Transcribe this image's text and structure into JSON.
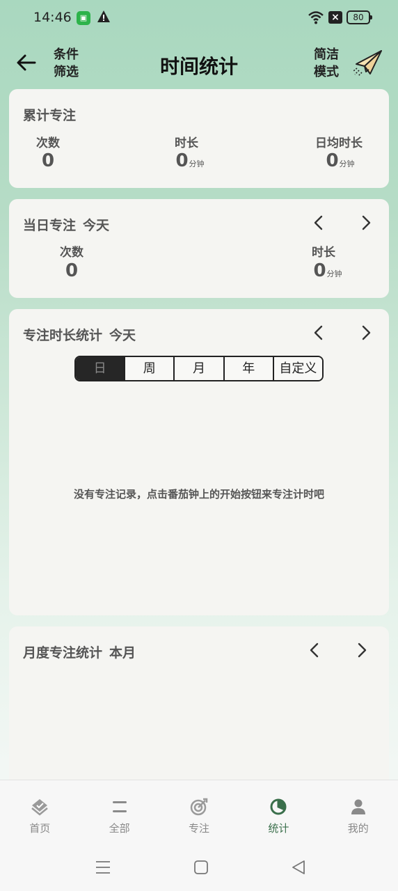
{
  "status_bar": {
    "time": "14:46",
    "battery": "80"
  },
  "header": {
    "title": "时间统计",
    "filter_label": "条件\n筛选",
    "simple_mode_label": "简洁\n模式"
  },
  "cumulative": {
    "title": "累计专注",
    "count_label": "次数",
    "count_value": "0",
    "duration_label": "时长",
    "duration_value": "0",
    "duration_unit": "分钟",
    "daily_avg_label": "日均时长",
    "daily_avg_value": "0",
    "daily_avg_unit": "分钟"
  },
  "daily": {
    "title": "当日专注",
    "period": "今天",
    "count_label": "次数",
    "count_value": "0",
    "duration_label": "时长",
    "duration_value": "0",
    "duration_unit": "分钟"
  },
  "duration_stats": {
    "title": "专注时长统计",
    "period": "今天",
    "tabs": [
      "日",
      "周",
      "月",
      "年",
      "自定义"
    ],
    "active_tab": 0,
    "empty_message": "没有专注记录，点击番茄钟上的开始按钮来专注计时吧"
  },
  "monthly": {
    "title": "月度专注统计",
    "period": "本月"
  },
  "bottom_nav": [
    {
      "label": "首页",
      "icon": "home-icon"
    },
    {
      "label": "全部",
      "icon": "list-icon"
    },
    {
      "label": "专注",
      "icon": "target-icon"
    },
    {
      "label": "统计",
      "icon": "pie-chart-icon",
      "active": true
    },
    {
      "label": "我的",
      "icon": "user-icon"
    }
  ],
  "colors": {
    "active_nav": "#3a6f4b",
    "header_gradient_top": "#a9d8bf"
  }
}
